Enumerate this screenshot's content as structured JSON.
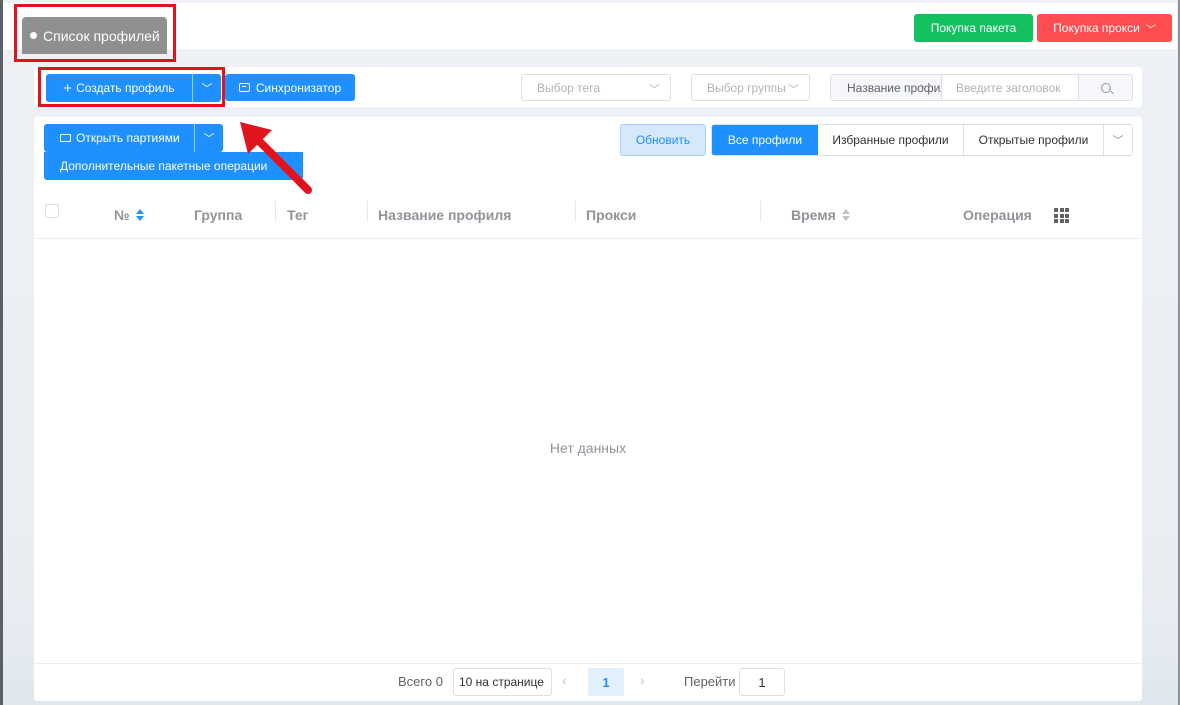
{
  "topbar": {
    "tab_label": "Список профилей",
    "buy_package_label": "Покупка пакета",
    "buy_proxy_label": "Покупка прокси"
  },
  "toolbar": {
    "create_profile_label": "Создать профиль",
    "synchronizer_label": "Синхронизатор",
    "tag_select_placeholder": "Выбор тега",
    "group_select_placeholder": "Выбор группы",
    "search_type_value": "Название профиля",
    "search_placeholder": "Введите заголовок"
  },
  "actions": {
    "open_batch_label": "Открыть партиями",
    "extra_batch_label": "Дополнительные пакетные операции",
    "refresh_label": "Обновить"
  },
  "filter_tabs": {
    "all": "Все профили",
    "favorites": "Избранные профили",
    "opened": "Открытые профили",
    "active": "all"
  },
  "table": {
    "columns": {
      "number": "№",
      "group": "Группа",
      "tag": "Тег",
      "profile_name": "Название профиля",
      "proxy": "Прокси",
      "time": "Время",
      "operation": "Операция"
    },
    "rows": [],
    "empty_text": "Нет данных"
  },
  "pagination": {
    "total_label": "Всего 0",
    "page_size": "10 на странице",
    "current_page": "1",
    "goto_label": "Перейти",
    "goto_value": "1"
  },
  "colors": {
    "primary": "#1e90ff",
    "buy_package": "#13c15f",
    "buy_proxy": "#ff4d51",
    "annotation": "#e0141f"
  }
}
